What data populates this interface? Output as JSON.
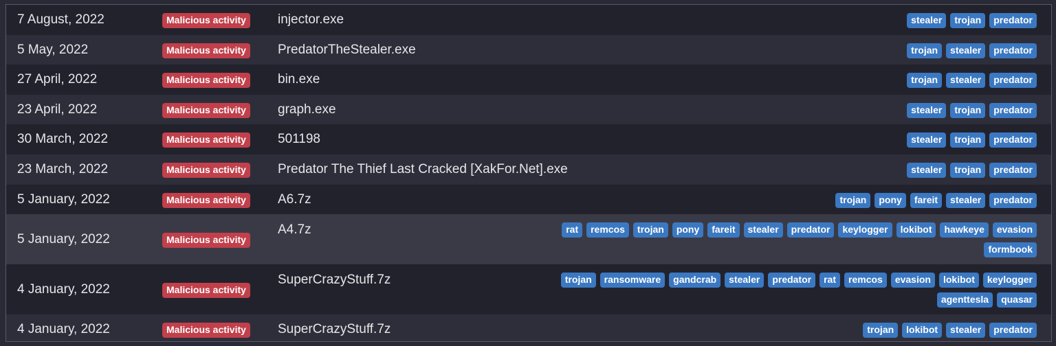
{
  "rows": [
    {
      "date": "7 August, 2022",
      "verdict": "Malicious activity",
      "filename": "injector.exe",
      "tags": [
        "stealer",
        "trojan",
        "predator"
      ]
    },
    {
      "date": "5 May, 2022",
      "verdict": "Malicious activity",
      "filename": "PredatorTheStealer.exe",
      "tags": [
        "trojan",
        "stealer",
        "predator"
      ]
    },
    {
      "date": "27 April, 2022",
      "verdict": "Malicious activity",
      "filename": "bin.exe",
      "tags": [
        "trojan",
        "stealer",
        "predator"
      ]
    },
    {
      "date": "23 April, 2022",
      "verdict": "Malicious activity",
      "filename": "graph.exe",
      "tags": [
        "stealer",
        "trojan",
        "predator"
      ]
    },
    {
      "date": "30 March, 2022",
      "verdict": "Malicious activity",
      "filename": "501198",
      "tags": [
        "stealer",
        "trojan",
        "predator"
      ]
    },
    {
      "date": "23 March, 2022",
      "verdict": "Malicious activity",
      "filename": "Predator The Thief Last Cracked [XakFor.Net].exe",
      "tags": [
        "stealer",
        "trojan",
        "predator"
      ]
    },
    {
      "date": "5 January, 2022",
      "verdict": "Malicious activity",
      "filename": "A6.7z",
      "tags": [
        "trojan",
        "pony",
        "fareit",
        "stealer",
        "predator"
      ]
    },
    {
      "date": "5 January, 2022",
      "verdict": "Malicious activity",
      "filename": "A4.7z",
      "tags": [
        "rat",
        "remcos",
        "trojan",
        "pony",
        "fareit",
        "stealer",
        "predator",
        "keylogger",
        "lokibot",
        "hawkeye",
        "evasion",
        "formbook"
      ]
    },
    {
      "date": "4 January, 2022",
      "verdict": "Malicious activity",
      "filename": "SuperCrazyStuff.7z",
      "tags": [
        "trojan",
        "ransomware",
        "gandcrab",
        "stealer",
        "predator",
        "rat",
        "remcos",
        "evasion",
        "lokibot",
        "keylogger",
        "agenttesla",
        "quasar"
      ]
    },
    {
      "date": "4 January, 2022",
      "verdict": "Malicious activity",
      "filename": "SuperCrazyStuff.7z",
      "tags": [
        "trojan",
        "lokibot",
        "stealer",
        "predator"
      ]
    }
  ]
}
